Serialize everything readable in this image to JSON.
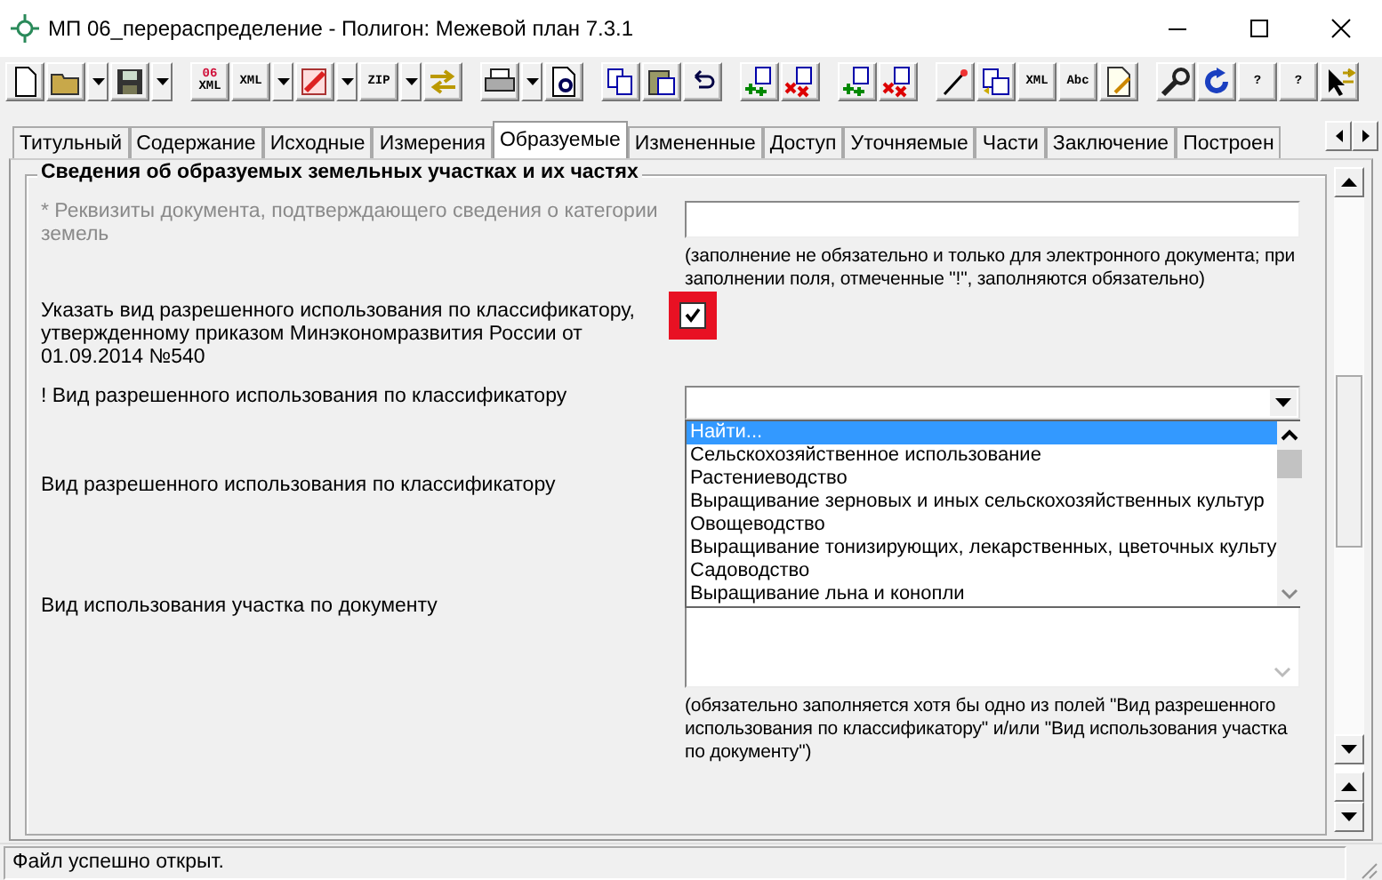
{
  "window": {
    "title": "МП 06_перераспределение - Полигон: Межевой план 7.3.1"
  },
  "toolbar": [
    [
      {
        "kind": "button"
      },
      {
        "kind": "button"
      },
      {
        "kind": "dropdown"
      },
      {
        "kind": "button"
      },
      {
        "kind": "dropdown"
      }
    ],
    [
      {
        "kind": "button",
        "text": [
          "06",
          "XML"
        ]
      },
      {
        "kind": "button",
        "text": [
          "XML"
        ]
      },
      {
        "kind": "dropdown"
      },
      {
        "kind": "button"
      },
      {
        "kind": "dropdown"
      },
      {
        "kind": "button",
        "text": [
          "ZIP"
        ]
      },
      {
        "kind": "dropdown"
      },
      {
        "kind": "button"
      }
    ],
    [
      {
        "kind": "button"
      },
      {
        "kind": "dropdown"
      },
      {
        "kind": "button"
      }
    ],
    [
      {
        "kind": "button"
      },
      {
        "kind": "button"
      },
      {
        "kind": "button"
      }
    ],
    [
      {
        "kind": "button"
      },
      {
        "kind": "button"
      }
    ],
    [
      {
        "kind": "button"
      },
      {
        "kind": "button"
      }
    ],
    [
      {
        "kind": "button"
      },
      {
        "kind": "button"
      },
      {
        "kind": "button",
        "text": [
          "XML"
        ]
      },
      {
        "kind": "button",
        "text": [
          "Abc"
        ]
      },
      {
        "kind": "button"
      }
    ],
    [
      {
        "kind": "button"
      },
      {
        "kind": "button"
      },
      {
        "kind": "button",
        "text": [
          "?"
        ]
      },
      {
        "kind": "button",
        "text": [
          "?"
        ]
      },
      {
        "kind": "button"
      }
    ]
  ],
  "tabs": [
    {
      "label": "Титульный",
      "selected": false
    },
    {
      "label": "Содержание",
      "selected": false
    },
    {
      "label": "Исходные",
      "selected": false
    },
    {
      "label": "Измерения",
      "selected": false
    },
    {
      "label": "Образуемые",
      "selected": true
    },
    {
      "label": "Измененные",
      "selected": false
    },
    {
      "label": "Доступ",
      "selected": false
    },
    {
      "label": "Уточняемые",
      "selected": false
    },
    {
      "label": "Части",
      "selected": false
    },
    {
      "label": "Заключение",
      "selected": false
    },
    {
      "label": "Построен",
      "selected": false
    }
  ],
  "section": {
    "title": "Сведения об образуемых земельных участках и их частях",
    "rows": [
      {
        "kind": "text",
        "label": "* Реквизиты документа, подтверждающего сведения о категории земель",
        "disabled": true,
        "note": "(заполнение не обязательно и только для электронного документа; при заполнении поля, отмеченные \"!\", заполняются обязательно)"
      },
      {
        "kind": "checkbox",
        "label": "Указать вид разрешенного использования по классификатору, утвержденному приказом Минэкономразвития России от 01.09.2014 №540",
        "checked": true,
        "highlighted": true
      },
      {
        "kind": "combo",
        "label": "! Вид разрешенного использования по классификатору",
        "expanded": true,
        "options": [
          {
            "label": "Найти...",
            "selected": true
          },
          {
            "label": "Сельскохозяйственное использование",
            "selected": false
          },
          {
            "label": "Растениеводство",
            "selected": false
          },
          {
            "label": "Выращивание зерновых и иных сельскохозяйственных культур",
            "selected": false
          },
          {
            "label": "Овощеводство",
            "selected": false
          },
          {
            "label": "Выращивание тонизирующих, лекарственных, цветочных культу",
            "selected": false
          },
          {
            "label": "Садоводство",
            "selected": false
          },
          {
            "label": "Выращивание льна и конопли",
            "selected": false
          }
        ]
      },
      {
        "kind": "hidden",
        "label": "Вид разрешенного использования по классификатору"
      },
      {
        "kind": "memo",
        "label": "Вид использования участка по документу",
        "note": "(обязательно заполняется хотя бы одно из полей \"Вид разрешенного использования по классификатору\" и/или \"Вид использования участка по документу\")"
      }
    ]
  },
  "status_bar": {
    "text": "Файл успешно открыт."
  }
}
